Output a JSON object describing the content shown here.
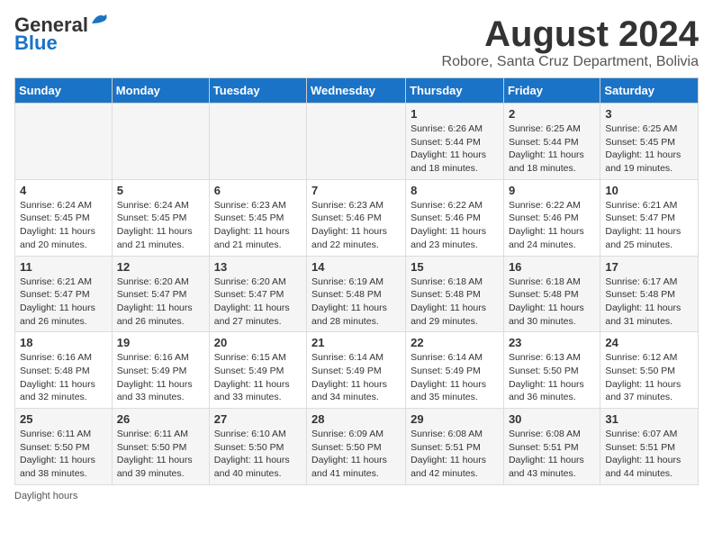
{
  "header": {
    "logo_line1": "General",
    "logo_line2": "Blue",
    "month_year": "August 2024",
    "location": "Robore, Santa Cruz Department, Bolivia"
  },
  "weekdays": [
    "Sunday",
    "Monday",
    "Tuesday",
    "Wednesday",
    "Thursday",
    "Friday",
    "Saturday"
  ],
  "weeks": [
    [
      {
        "day": "",
        "info": ""
      },
      {
        "day": "",
        "info": ""
      },
      {
        "day": "",
        "info": ""
      },
      {
        "day": "",
        "info": ""
      },
      {
        "day": "1",
        "info": "Sunrise: 6:26 AM\nSunset: 5:44 PM\nDaylight: 11 hours and 18 minutes."
      },
      {
        "day": "2",
        "info": "Sunrise: 6:25 AM\nSunset: 5:44 PM\nDaylight: 11 hours and 18 minutes."
      },
      {
        "day": "3",
        "info": "Sunrise: 6:25 AM\nSunset: 5:45 PM\nDaylight: 11 hours and 19 minutes."
      }
    ],
    [
      {
        "day": "4",
        "info": "Sunrise: 6:24 AM\nSunset: 5:45 PM\nDaylight: 11 hours and 20 minutes."
      },
      {
        "day": "5",
        "info": "Sunrise: 6:24 AM\nSunset: 5:45 PM\nDaylight: 11 hours and 21 minutes."
      },
      {
        "day": "6",
        "info": "Sunrise: 6:23 AM\nSunset: 5:45 PM\nDaylight: 11 hours and 21 minutes."
      },
      {
        "day": "7",
        "info": "Sunrise: 6:23 AM\nSunset: 5:46 PM\nDaylight: 11 hours and 22 minutes."
      },
      {
        "day": "8",
        "info": "Sunrise: 6:22 AM\nSunset: 5:46 PM\nDaylight: 11 hours and 23 minutes."
      },
      {
        "day": "9",
        "info": "Sunrise: 6:22 AM\nSunset: 5:46 PM\nDaylight: 11 hours and 24 minutes."
      },
      {
        "day": "10",
        "info": "Sunrise: 6:21 AM\nSunset: 5:47 PM\nDaylight: 11 hours and 25 minutes."
      }
    ],
    [
      {
        "day": "11",
        "info": "Sunrise: 6:21 AM\nSunset: 5:47 PM\nDaylight: 11 hours and 26 minutes."
      },
      {
        "day": "12",
        "info": "Sunrise: 6:20 AM\nSunset: 5:47 PM\nDaylight: 11 hours and 26 minutes."
      },
      {
        "day": "13",
        "info": "Sunrise: 6:20 AM\nSunset: 5:47 PM\nDaylight: 11 hours and 27 minutes."
      },
      {
        "day": "14",
        "info": "Sunrise: 6:19 AM\nSunset: 5:48 PM\nDaylight: 11 hours and 28 minutes."
      },
      {
        "day": "15",
        "info": "Sunrise: 6:18 AM\nSunset: 5:48 PM\nDaylight: 11 hours and 29 minutes."
      },
      {
        "day": "16",
        "info": "Sunrise: 6:18 AM\nSunset: 5:48 PM\nDaylight: 11 hours and 30 minutes."
      },
      {
        "day": "17",
        "info": "Sunrise: 6:17 AM\nSunset: 5:48 PM\nDaylight: 11 hours and 31 minutes."
      }
    ],
    [
      {
        "day": "18",
        "info": "Sunrise: 6:16 AM\nSunset: 5:48 PM\nDaylight: 11 hours and 32 minutes."
      },
      {
        "day": "19",
        "info": "Sunrise: 6:16 AM\nSunset: 5:49 PM\nDaylight: 11 hours and 33 minutes."
      },
      {
        "day": "20",
        "info": "Sunrise: 6:15 AM\nSunset: 5:49 PM\nDaylight: 11 hours and 33 minutes."
      },
      {
        "day": "21",
        "info": "Sunrise: 6:14 AM\nSunset: 5:49 PM\nDaylight: 11 hours and 34 minutes."
      },
      {
        "day": "22",
        "info": "Sunrise: 6:14 AM\nSunset: 5:49 PM\nDaylight: 11 hours and 35 minutes."
      },
      {
        "day": "23",
        "info": "Sunrise: 6:13 AM\nSunset: 5:50 PM\nDaylight: 11 hours and 36 minutes."
      },
      {
        "day": "24",
        "info": "Sunrise: 6:12 AM\nSunset: 5:50 PM\nDaylight: 11 hours and 37 minutes."
      }
    ],
    [
      {
        "day": "25",
        "info": "Sunrise: 6:11 AM\nSunset: 5:50 PM\nDaylight: 11 hours and 38 minutes."
      },
      {
        "day": "26",
        "info": "Sunrise: 6:11 AM\nSunset: 5:50 PM\nDaylight: 11 hours and 39 minutes."
      },
      {
        "day": "27",
        "info": "Sunrise: 6:10 AM\nSunset: 5:50 PM\nDaylight: 11 hours and 40 minutes."
      },
      {
        "day": "28",
        "info": "Sunrise: 6:09 AM\nSunset: 5:50 PM\nDaylight: 11 hours and 41 minutes."
      },
      {
        "day": "29",
        "info": "Sunrise: 6:08 AM\nSunset: 5:51 PM\nDaylight: 11 hours and 42 minutes."
      },
      {
        "day": "30",
        "info": "Sunrise: 6:08 AM\nSunset: 5:51 PM\nDaylight: 11 hours and 43 minutes."
      },
      {
        "day": "31",
        "info": "Sunrise: 6:07 AM\nSunset: 5:51 PM\nDaylight: 11 hours and 44 minutes."
      }
    ]
  ],
  "footer": {
    "daylight_label": "Daylight hours"
  }
}
